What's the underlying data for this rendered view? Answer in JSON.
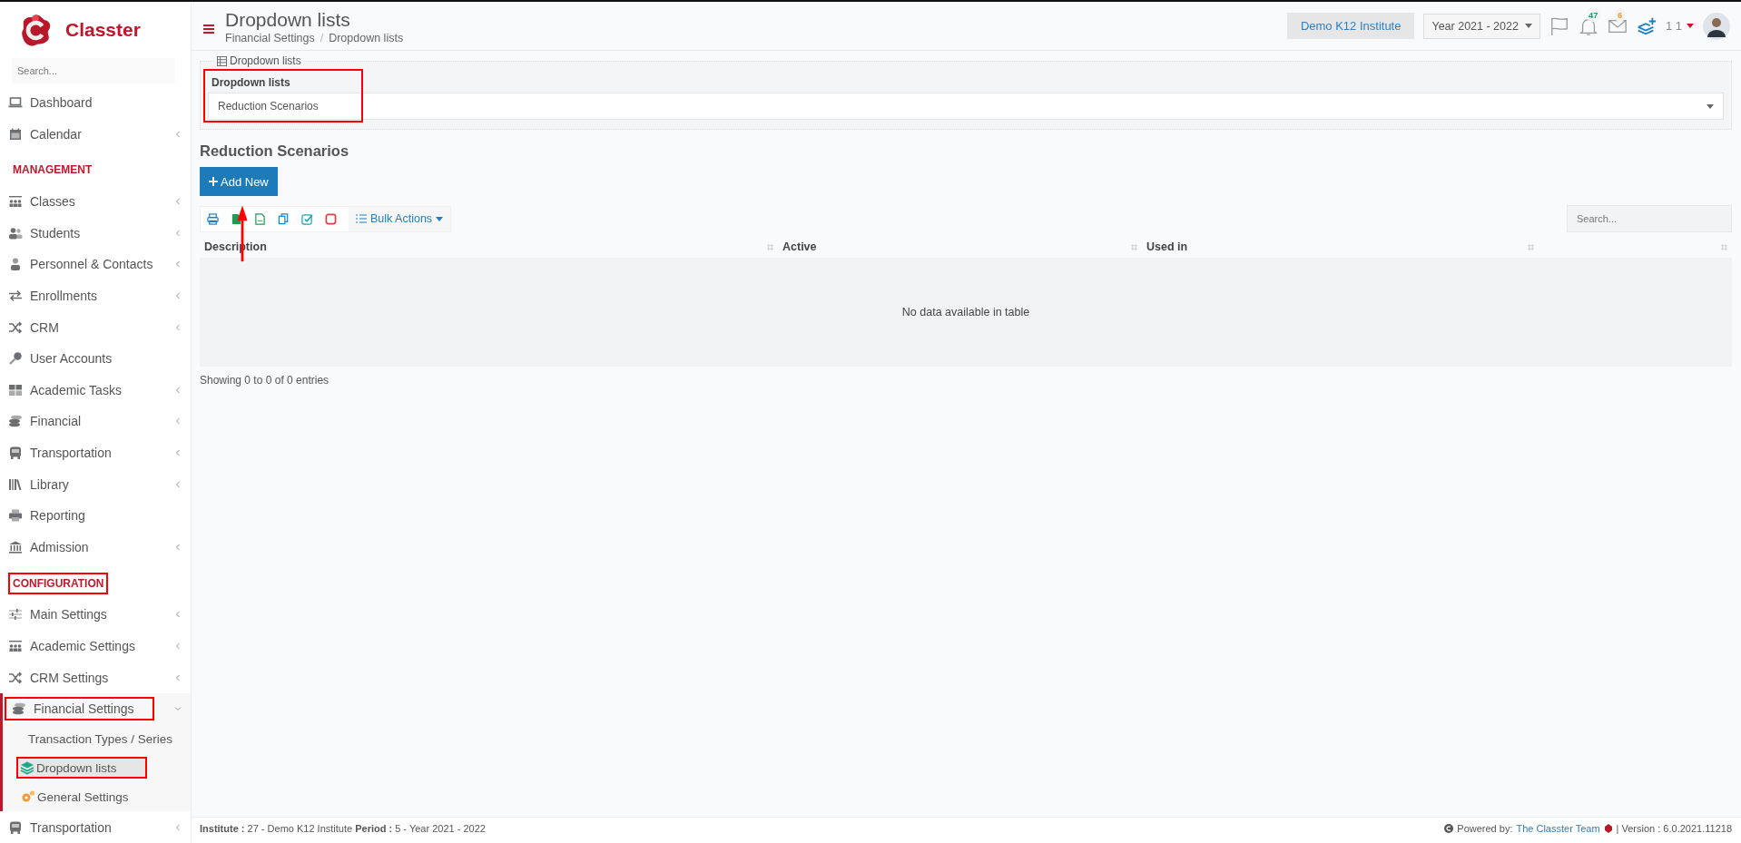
{
  "brand": {
    "name": "Classter"
  },
  "sidebar": {
    "search": {
      "placeholder": "Search..."
    },
    "items": [
      {
        "kind": "link",
        "label": "Dashboard",
        "submenu": false
      },
      {
        "kind": "link",
        "label": "Calendar",
        "submenu": true
      },
      {
        "kind": "header",
        "label": "MANAGEMENT"
      },
      {
        "kind": "link",
        "label": "Classes",
        "submenu": true
      },
      {
        "kind": "link",
        "label": "Students",
        "submenu": true
      },
      {
        "kind": "link",
        "label": "Personnel & Contacts",
        "submenu": true
      },
      {
        "kind": "link",
        "label": "Enrollments",
        "submenu": true
      },
      {
        "kind": "link",
        "label": "CRM",
        "submenu": true
      },
      {
        "kind": "link",
        "label": "User Accounts",
        "submenu": false
      },
      {
        "kind": "link",
        "label": "Academic Tasks",
        "submenu": true
      },
      {
        "kind": "link",
        "label": "Financial",
        "submenu": true
      },
      {
        "kind": "link",
        "label": "Transportation",
        "submenu": true
      },
      {
        "kind": "link",
        "label": "Library",
        "submenu": true
      },
      {
        "kind": "link",
        "label": "Reporting",
        "submenu": false
      },
      {
        "kind": "link",
        "label": "Admission",
        "submenu": true
      },
      {
        "kind": "header",
        "label": "CONFIGURATION",
        "annotated": true
      },
      {
        "kind": "link",
        "label": "Main Settings",
        "submenu": true
      },
      {
        "kind": "link",
        "label": "Academic Settings",
        "submenu": true
      },
      {
        "kind": "link",
        "label": "CRM Settings",
        "submenu": true
      },
      {
        "kind": "group",
        "label": "Financial Settings",
        "expanded": true,
        "annotated": true,
        "children": [
          {
            "label": "Transaction Types / Series",
            "selected": false
          },
          {
            "label": "Dropdown lists",
            "selected": true,
            "annotated": true
          },
          {
            "label": "General Settings",
            "selected": false
          }
        ]
      },
      {
        "kind": "link",
        "label": "Transportation",
        "submenu": true
      }
    ]
  },
  "header": {
    "title": "Dropdown lists",
    "breadcrumb": [
      "Financial Settings",
      "Dropdown lists"
    ],
    "breadcrumb_separator": "/",
    "institute": "Demo K12 Institute",
    "year": "Year 2021 - 2022",
    "notifications": "47",
    "messages": "6",
    "user": "1 1"
  },
  "filter": {
    "legend": "Dropdown lists",
    "label": "Dropdown lists",
    "value": "Reduction Scenarios",
    "annotated": true
  },
  "section": {
    "title": "Reduction Scenarios",
    "add_button": "Add New",
    "bulk_actions": "Bulk Actions",
    "search": {
      "placeholder": "Search..."
    }
  },
  "table": {
    "columns": [
      "Description",
      "Active",
      "Used in"
    ],
    "empty_message": "No data available in table",
    "info": "Showing 0 to 0 of 0 entries"
  },
  "footer": {
    "info": "**Institute :** 27 - Demo K12 Institute **Period :** 5 - Year 2021 - 2022",
    "powered": "Powered by:",
    "team": "The Classter Team",
    "version": "| Version : 6.0.2021.11218"
  }
}
